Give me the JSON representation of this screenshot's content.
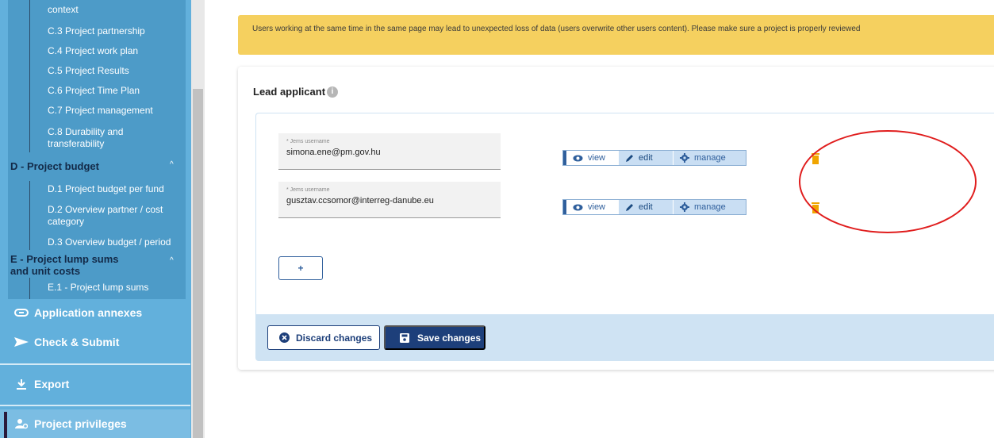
{
  "sidebar": {
    "c_items": [
      "context",
      "C.3 Project partnership",
      "C.4 Project work plan",
      "C.5 Project Results",
      "C.6 Project Time Plan",
      "C.7 Project management",
      "C.8 Durability and",
      "transferability"
    ],
    "section_d": {
      "label": "D - Project budget",
      "chevron": "^"
    },
    "d_items": [
      "D.1 Project budget per fund",
      "D.2 Overview partner / cost",
      "category",
      "D.3 Overview budget / period"
    ],
    "section_e": {
      "label_line1": "E - Project lump sums",
      "label_line2": "and unit costs",
      "chevron": "^"
    },
    "e_items": [
      "E.1 - Project lump sums"
    ],
    "main_items": [
      {
        "label": "Application annexes",
        "icon": "paperclip-icon"
      },
      {
        "label": "Check & Submit",
        "icon": "send-icon"
      },
      {
        "label": "Export",
        "icon": "download-icon"
      },
      {
        "label": "Project privileges",
        "icon": "users-cog-icon"
      }
    ]
  },
  "main": {
    "warning": "Users working at the same time in the same page may lead to unexpected loss of data (users overwrite other users content). Please make sure a project is properly reviewed",
    "section_title": "Lead applicant",
    "info_icon_glyph": "i",
    "field_label": "* Jems username",
    "users": [
      {
        "username": "simona.ene@pm.gov.hu"
      },
      {
        "username": "gusztav.ccsomor@interreg-danube.eu"
      }
    ],
    "perm_labels": {
      "view": "view",
      "edit": "edit",
      "manage": "manage"
    },
    "add_button": "+",
    "discard_button": "Discard changes",
    "save_button": "Save changes"
  },
  "colors": {
    "sidebar": "#62b0dc",
    "sidebar_tree": "#4d9bc8",
    "warning": "#f5d05f",
    "primary": "#1d3f7a",
    "trash": "#f0a500",
    "annotation": "#e01d1d"
  }
}
